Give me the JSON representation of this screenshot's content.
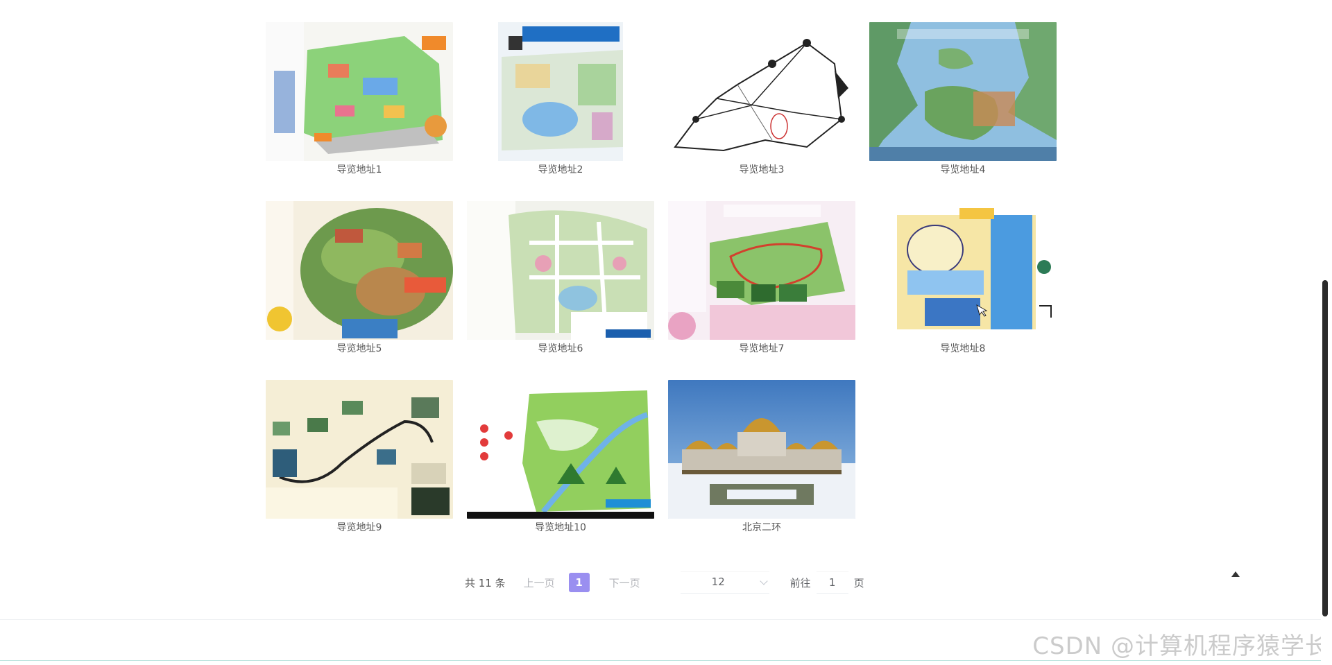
{
  "gallery": [
    {
      "caption": "导览地址1",
      "thumb": "park-map-green"
    },
    {
      "caption": "导览地址2",
      "thumb": "map-with-lake"
    },
    {
      "caption": "导览地址3",
      "thumb": "line-route-map"
    },
    {
      "caption": "导览地址4",
      "thumb": "lake-scenic-map"
    },
    {
      "caption": "导览地址5",
      "thumb": "mountain-town-map"
    },
    {
      "caption": "导览地址6",
      "thumb": "resort-core-map"
    },
    {
      "caption": "导览地址7",
      "thumb": "flower-park-map"
    },
    {
      "caption": "导览地址8",
      "thumb": "aquarium-map"
    },
    {
      "caption": "导览地址9",
      "thumb": "shennongjia-map"
    },
    {
      "caption": "导览地址10",
      "thumb": "green-valley-map"
    },
    {
      "caption": "北京二环",
      "thumb": "palace-snow-photo"
    }
  ],
  "pagination": {
    "total": "共 11 条",
    "prev": "上一页",
    "current": "1",
    "next": "下一页",
    "page_size": "12",
    "goto_label": "前往",
    "goto_value": "1",
    "page_unit": "页"
  },
  "watermark": "CSDN @计算机程序猿学长",
  "colors": {
    "accent": "#9a8ff0"
  }
}
